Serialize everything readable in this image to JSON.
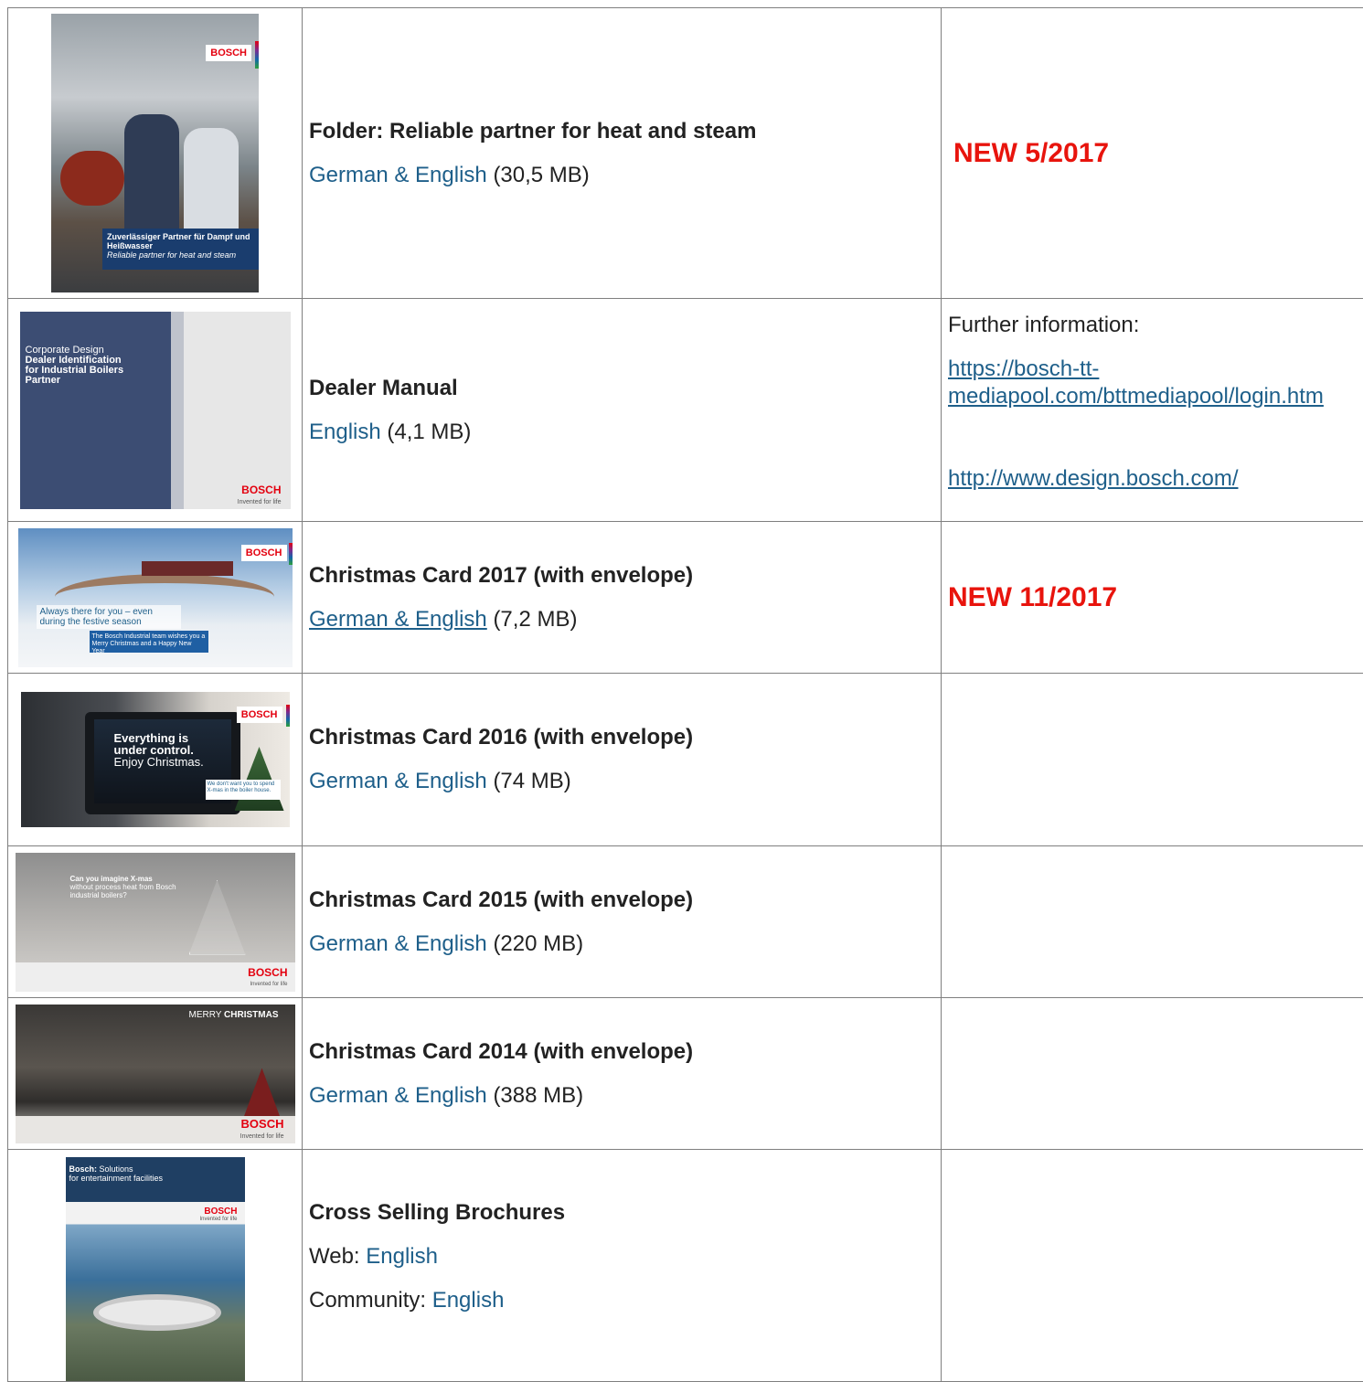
{
  "rows": [
    {
      "title": "Folder:  Reliable partner for heat and steam",
      "link_label": "German & English",
      "size": "(30,5 MB)",
      "badge": "NEW 5/2017",
      "thumb": {
        "brand": "BOSCH",
        "caption_de": "Zuverlässiger Partner für Dampf und Heißwasser",
        "caption_en": "Reliable partner for heat and steam"
      }
    },
    {
      "title": "Dealer Manual",
      "link_label": "English",
      "size": "(4,1 MB)",
      "info_label": "Further information:",
      "info_links": [
        "https://bosch-tt-mediapool.com/bttmediapool/login.htm",
        "http://www.design.bosch.com/"
      ],
      "thumb": {
        "line1": "Corporate Design",
        "line2": "Dealer Identification",
        "line3": "for Industrial Boilers",
        "line4": "Partner",
        "brand": "BOSCH",
        "slogan": "Invented for life"
      }
    },
    {
      "title": "Christmas Card 2017 (with envelope)",
      "link_label": "German & English",
      "size": "(7,2 MB)",
      "badge": "NEW 11/2017",
      "thumb": {
        "headline": "Always there for you – even during the festive season",
        "footer": "The Bosch Industrial team wishes you a Merry Christmas and a Happy New Year",
        "brand": "BOSCH"
      }
    },
    {
      "title": "Christmas Card 2016 (with envelope)",
      "link_label": "German & English",
      "size": "(74 MB)",
      "thumb": {
        "line1": "Everything is",
        "line2": "under control.",
        "line3": "Enjoy Christmas.",
        "side": "We don't want you to spend X-mas in the boiler house.",
        "brand": "BOSCH"
      }
    },
    {
      "title": "Christmas Card 2015 (with envelope)",
      "link_label": "German & English",
      "size": "(220 MB)",
      "thumb": {
        "headline": "Can you imagine X-mas",
        "sub": "without process heat from Bosch industrial boilers?",
        "brand": "BOSCH",
        "slogan": "Invented for life"
      }
    },
    {
      "title": "Christmas Card 2014 (with envelope)",
      "link_label": "German & English",
      "size": "(388 MB)",
      "thumb": {
        "merry": "MERRY",
        "christmas": "CHRISTMAS",
        "brand": "BOSCH",
        "slogan": "Invented for life"
      }
    },
    {
      "title": "Cross Selling Brochures",
      "web_prefix": "Web:",
      "web_link": "English",
      "community_prefix": "Community:",
      "community_link": "English",
      "thumb": {
        "line1": "Bosch:",
        "line1b": "Solutions",
        "line2": "for entertainment facilities",
        "brand": "BOSCH",
        "slogan": "Invented for life"
      }
    }
  ],
  "colors": {
    "link": "#1e5f8a",
    "badge": "#e8140d",
    "border": "#7f7f7f"
  }
}
